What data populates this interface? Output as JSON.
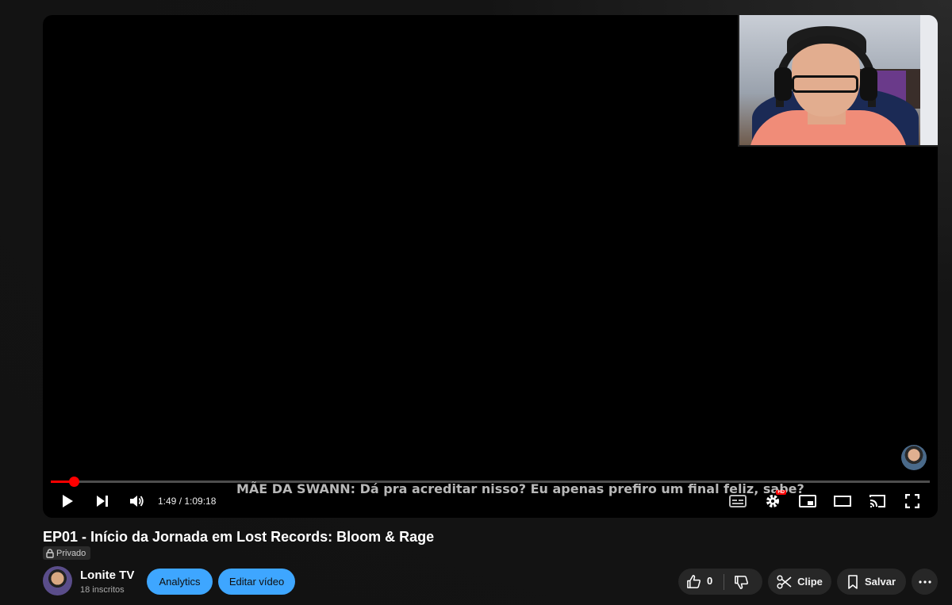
{
  "player": {
    "subtitle": "MÃE DA SWANN: Dá pra acreditar nisso? Eu apenas prefiro um final feliz, sabe?",
    "current_time": "1:49",
    "duration": "1:09:18",
    "time_display": "1:49 / 1:09:18",
    "progress_fraction": 0.0263,
    "quality_badge": "HD",
    "accent_color": "#ff0000"
  },
  "video": {
    "title": "EP01 - Início da Jornada em Lost Records: Bloom & Rage",
    "privacy": "Privado"
  },
  "channel": {
    "name": "Lonite TV",
    "subscribers": "18 inscritos"
  },
  "actions": {
    "analytics": "Analytics",
    "edit": "Editar vídeo",
    "likes": "0",
    "clip": "Clipe",
    "save": "Salvar",
    "button_color": "#3ea6ff"
  }
}
